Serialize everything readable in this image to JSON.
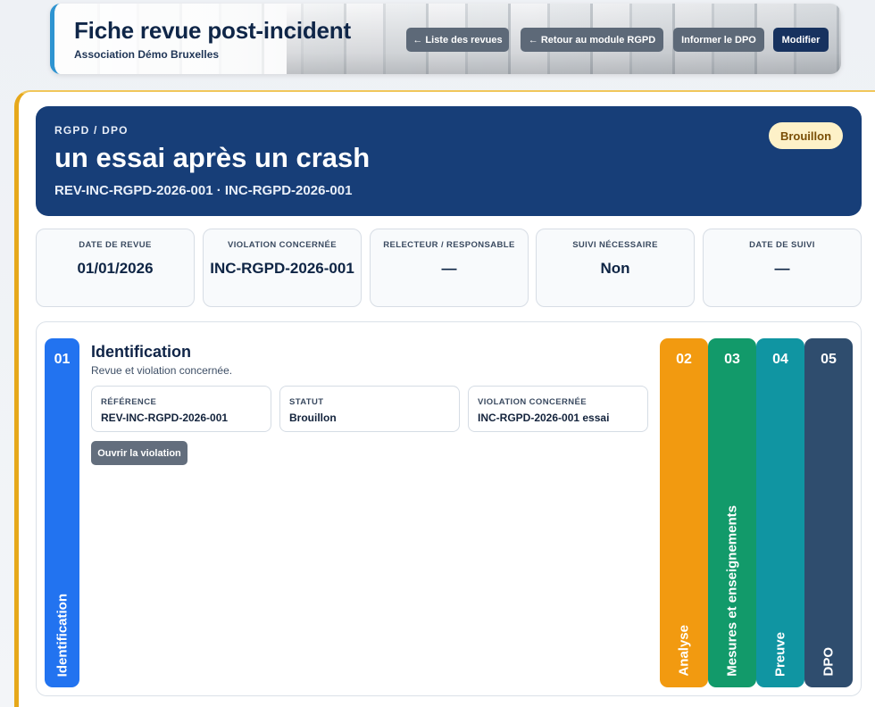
{
  "header": {
    "title": "Fiche revue post-incident",
    "subtitle": "Association Démo Bruxelles",
    "buttons": {
      "list": "← Liste des revues",
      "back": "← Retour au module RGPD",
      "inform": "Informer le DPO",
      "edit": "Modifier"
    }
  },
  "banner": {
    "kicker": "RGPD / DPO",
    "title": "un essai après un crash",
    "reference": "REV-INC-RGPD-2026-001 · INC-RGPD-2026-001",
    "status_badge": "Brouillon"
  },
  "info_cards": [
    {
      "label": "DATE DE REVUE",
      "value": "01/01/2026"
    },
    {
      "label": "VIOLATION CONCERNÉE",
      "value": "INC-RGPD-2026-001"
    },
    {
      "label": "RELECTEUR / RESPONSABLE",
      "value": "—"
    },
    {
      "label": "SUIVI NÉCESSAIRE",
      "value": "Non"
    },
    {
      "label": "DATE DE SUIVI",
      "value": "—"
    }
  ],
  "sections": {
    "active": {
      "number": "01",
      "label": "Identification",
      "title": "Identification",
      "description": "Revue et violation concernée.",
      "fields": [
        {
          "label": "RÉFÉRENCE",
          "value": "REV-INC-RGPD-2026-001"
        },
        {
          "label": "STATUT",
          "value": "Brouillon"
        },
        {
          "label": "VIOLATION CONCERNÉE",
          "value": "INC-RGPD-2026-001 essai"
        }
      ],
      "open_button": "Ouvrir la violation"
    },
    "tabs": [
      {
        "number": "02",
        "label": "Analyse",
        "color": "#f29a10"
      },
      {
        "number": "03",
        "label": "Mesures et enseignements",
        "color": "#129a6a"
      },
      {
        "number": "04",
        "label": "Preuve",
        "color": "#1095a2"
      },
      {
        "number": "05",
        "label": "DPO",
        "color": "#2f4d6e"
      }
    ],
    "active_color": "#2273f0"
  },
  "colors": {
    "navy": "#173e78",
    "accent_gold": "#e6a81b",
    "header_accent": "#2e94d1"
  }
}
